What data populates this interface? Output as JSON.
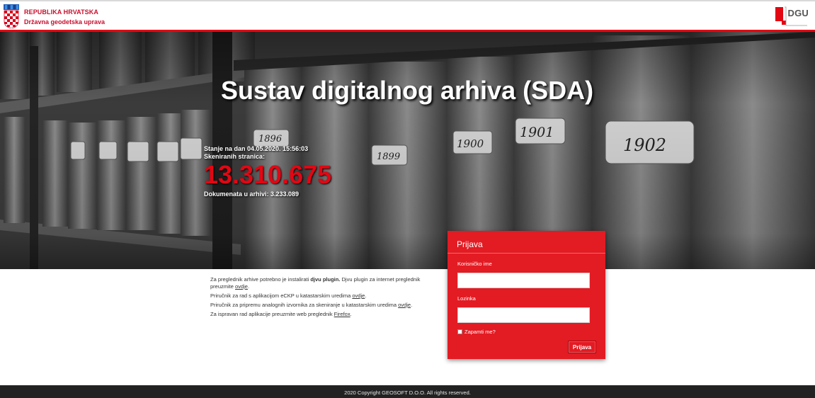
{
  "header": {
    "brand_line1": "REPUBLIKA HRVATSKA",
    "brand_line2": "Državna geodetska uprava",
    "logo_text": "DGU",
    "crest_icon": "croatian-coat-of-arms-icon"
  },
  "hero": {
    "title": "Sustav digitalnog arhiva (SDA)",
    "stats": {
      "date_line": "Stanje na dan 04.05.2020. 15:56:03",
      "pages_label": "Skeniranih stranica:",
      "pages_value": "13.310.675",
      "docs_line": "Dokumenata u arhivi: 3.233.089"
    },
    "book_labels": [
      "1896",
      "1899",
      "1900",
      "1901",
      "1902"
    ]
  },
  "info": {
    "line1_prefix": "Za preglednik arhive potrebno je instalirati ",
    "line1_bold": "djvu plugin.",
    "line1_suffix": " Djvu plugin za internet preglednik preuzmite ",
    "line1_link": "ovdje",
    "line1_end": ".",
    "line2_text": "Priručnik za rad s aplikacijom eCKP u katastarskim uredima ",
    "line2_link": "ovdje",
    "line2_end": ".",
    "line3_text": "Priručnik za pripremu analognih izvornika za skeniranje u katastarskim uredima ",
    "line3_link": "ovdje",
    "line3_end": ".",
    "line4_text": "Za ispravan rad aplikacije preuzmite web preglednik ",
    "line4_link": "Firefox",
    "line4_end": "."
  },
  "login": {
    "title": "Prijava",
    "username_label": "Korisničko ime",
    "username_value": "",
    "password_label": "Lozinka",
    "password_value": "",
    "remember_label": "Zapamti me?",
    "submit_label": "Prijava"
  },
  "footer": {
    "copyright": "2020 Copyright GEOSOFT D.O.O. All rights reserved."
  },
  "colors": {
    "brand_red": "#e31b23",
    "footer_bg": "#222222"
  }
}
